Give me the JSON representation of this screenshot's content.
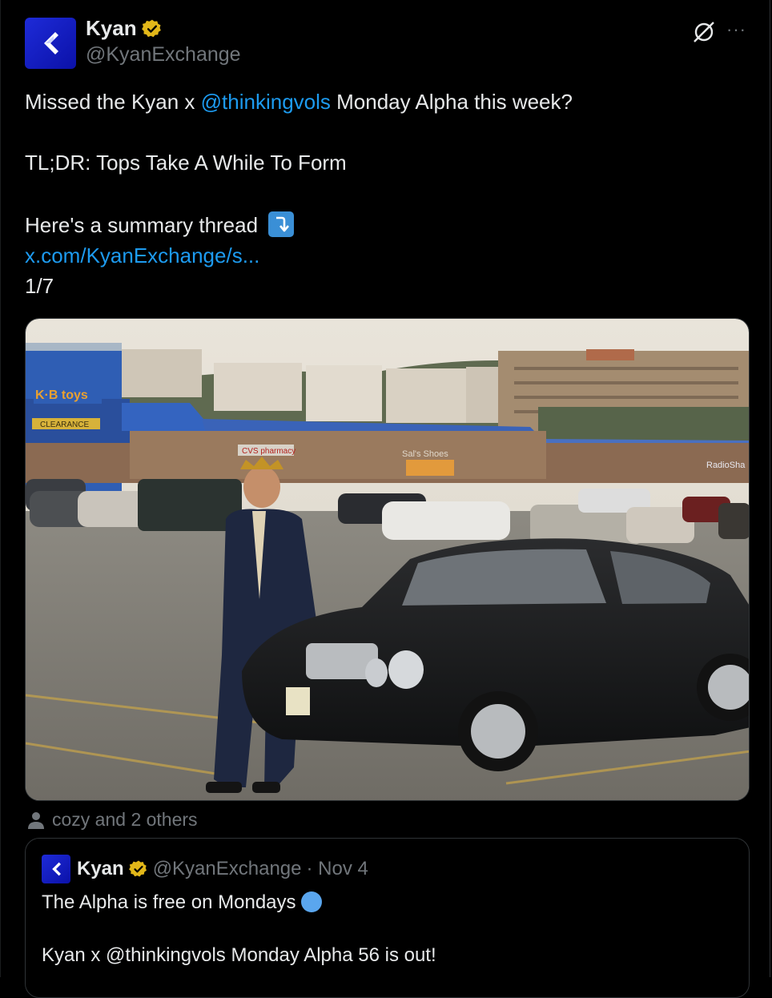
{
  "post": {
    "author_name": "Kyan",
    "author_handle": "@KyanExchange",
    "more_label": "···",
    "line1_pre": "Missed the Kyan x ",
    "line1_mention": "@thinkingvols",
    "line1_post": " Monday Alpha this week?",
    "line2": "TL;DR: Tops Take A While To Form",
    "line3": "Here's a summary thread",
    "link": "x.com/KyanExchange/s...",
    "counter": "1/7"
  },
  "media": {
    "sign_kb": "K·B toys",
    "sign_clearance": "CLEARANCE",
    "sign_cvs": "CVS pharmacy",
    "sign_radioshack": "RadioSha",
    "sign_store": "Sal's Shoes"
  },
  "tagged": {
    "text": "cozy and 2 others"
  },
  "quote": {
    "author_name": "Kyan",
    "author_handle": "@KyanExchange",
    "date": "· Nov 4",
    "line1": "The Alpha is free on Mondays",
    "line2": "Kyan x @thinkingvols Monday Alpha 56 is out!"
  },
  "colors": {
    "accent": "#1d9bf0",
    "verified": "#e2b719",
    "brand": "#1a25d0"
  },
  "icons": [
    "kyan-logo-icon",
    "verified-badge-icon",
    "grok-icon",
    "more-icon",
    "arrow-down-right-icon",
    "person-icon",
    "blue-circle-icon"
  ]
}
